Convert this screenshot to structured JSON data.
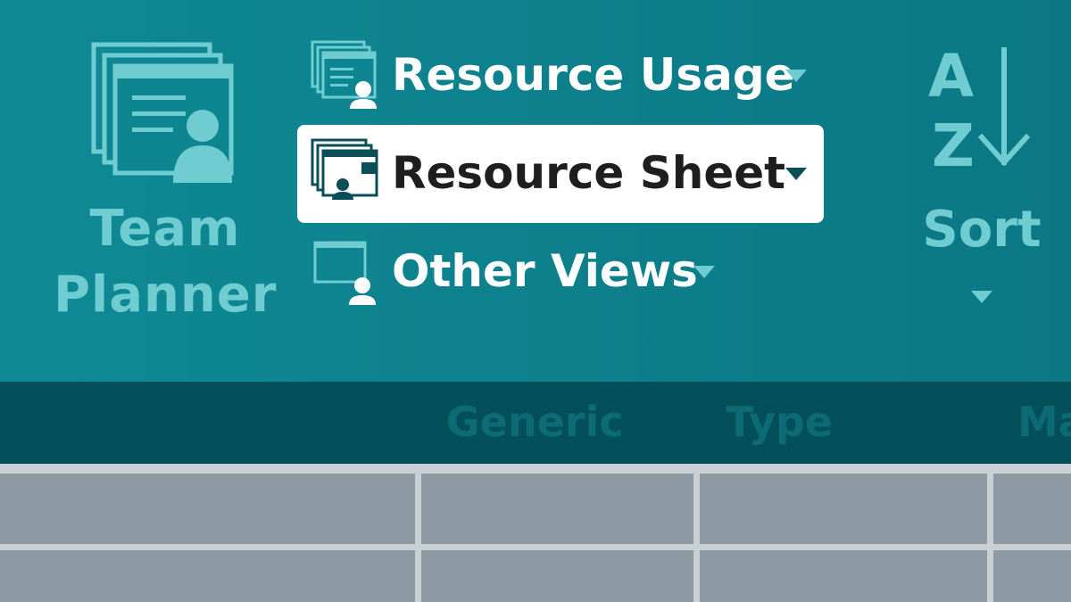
{
  "ribbon": {
    "team_planner": {
      "line1": "Team",
      "line2": "Planner",
      "icon": "team-planner-icon"
    },
    "views": [
      {
        "label": "Resource Usage",
        "icon": "resource-usage-icon",
        "selected": false
      },
      {
        "label": "Resource Sheet",
        "icon": "resource-sheet-icon",
        "selected": true
      },
      {
        "label": "Other Views",
        "icon": "other-views-icon",
        "selected": false
      }
    ],
    "sort": {
      "label": "Sort",
      "icon": "sort-az-icon"
    }
  },
  "table": {
    "columns": [
      "",
      "Generic",
      "Type",
      "Ma"
    ],
    "rows": [
      [
        "",
        "",
        "",
        ""
      ],
      [
        "",
        "",
        "",
        ""
      ]
    ]
  },
  "colors": {
    "ribbon": "#0f8a95",
    "accent_light": "#6fcdd1",
    "header_row": "#034f5a",
    "selected_bg": "#ffffff",
    "grid_cell": "#8d9aa3"
  }
}
